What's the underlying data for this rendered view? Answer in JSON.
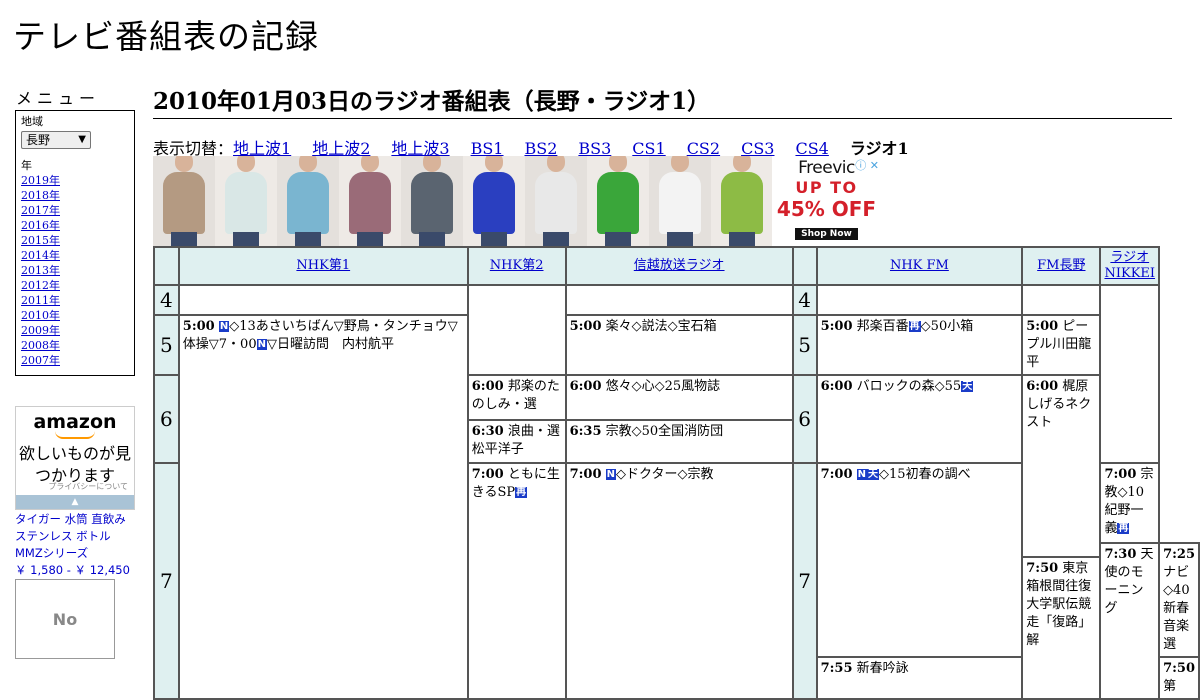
{
  "site": {
    "title": "テレビ番組表の記録"
  },
  "sidebar": {
    "menu_heading": "メニュー",
    "region_label": "地域",
    "region_selected": "長野",
    "year_label": "年",
    "years": [
      "2019年",
      "2018年",
      "2017年",
      "2016年",
      "2015年",
      "2014年",
      "2013年",
      "2012年",
      "2011年",
      "2010年",
      "2009年",
      "2008年",
      "2007年"
    ]
  },
  "ads": {
    "amazon": {
      "logo": "amazon",
      "tagline": "欲しいものが見つかります",
      "privacy": "プライバシーについて"
    },
    "product": {
      "name": "タイガー 水筒 直飲み ステンレス ボトル MMZシリーズ",
      "price": "￥ 1,580 - ￥ 12,450"
    },
    "noimage": "No",
    "banner": {
      "brand": "Freevic",
      "line1": "UP TO",
      "line2": "45% OFF",
      "cta": "Shop Now",
      "tile_colors": [
        "#b49a82",
        "#d9e7e6",
        "#7ab5d0",
        "#9a6b78",
        "#5a6470",
        "#2a3fc0",
        "#e8e8e8",
        "#3aa63a",
        "#f3f3f3",
        "#8dbb45"
      ]
    }
  },
  "main": {
    "page_title": "2010年01月03日のラジオ番組表（長野・ラジオ1）",
    "nav_label": "表示切替：",
    "nav_links": [
      "地上波1",
      "地上波2",
      "地上波3",
      "BS1",
      "BS2",
      "BS3",
      "CS1",
      "CS2",
      "CS3",
      "CS4"
    ],
    "nav_current": "ラジオ1"
  },
  "schedule": {
    "channels": [
      "NHK第1",
      "NHK第2",
      "信越放送ラジオ",
      "NHK FM",
      "FM長野",
      "ラジオNIKKEI"
    ],
    "hours": [
      "4",
      "5",
      "6",
      "7"
    ],
    "programs": {
      "nhk1_500": {
        "time": "5:00",
        "pre": "",
        "mid": "◇13あさいちばん▽野鳥・タンチョウ▽体操▽7・00",
        "post": "▽日曜訪問　内村航平",
        "b1": "N",
        "b2": "N"
      },
      "nhk1_750": {
        "time": "7:50",
        "text": "東京箱根間往復大学駅伝競走「復路」解"
      },
      "nhk2_600": {
        "time": "6:00",
        "text": "邦楽のたのしみ・選"
      },
      "nhk2_630": {
        "time": "6:30",
        "text": "浪曲・選　松平洋子"
      },
      "nhk2_700": {
        "time": "7:00",
        "text": "ともに生きるSP",
        "badge": "再"
      },
      "sbc_500": {
        "time": "5:00",
        "text": "楽々◇説法◇宝石箱"
      },
      "sbc_600": {
        "time": "6:00",
        "text": "悠々◇心◇25風物誌"
      },
      "sbc_635": {
        "time": "6:35",
        "text": "宗教◇50全国消防団"
      },
      "sbc_700": {
        "time": "7:00",
        "badge": "N",
        "text": "◇ドクター◇宗教"
      },
      "fm_500": {
        "time": "5:00",
        "text": "邦楽百番",
        "badge": "再",
        "text2": "◇50小箱"
      },
      "fm_600": {
        "time": "6:00",
        "text": "バロックの森◇55",
        "badge": "天"
      },
      "fm_700": {
        "time": "7:00",
        "badge": "N",
        "badge2": "天",
        "text": "◇15初春の調べ"
      },
      "fm_755": {
        "time": "7:55",
        "text": "新春吟詠"
      },
      "fmn_500": {
        "time": "5:00",
        "text": "ピープル川田龍平"
      },
      "fmn_600": {
        "time": "6:00",
        "text": "梶原しげるネクスト"
      },
      "fmn_730": {
        "time": "7:30",
        "text": "天使のモーニング"
      },
      "nik_700": {
        "time": "7:00",
        "text": "宗教◇10紀野一義",
        "badge": "再"
      },
      "nik_725": {
        "time": "7:25",
        "text": "ナビ◇40新春音楽選"
      },
      "nik_750": {
        "time": "7:50",
        "text": "第"
      }
    }
  }
}
